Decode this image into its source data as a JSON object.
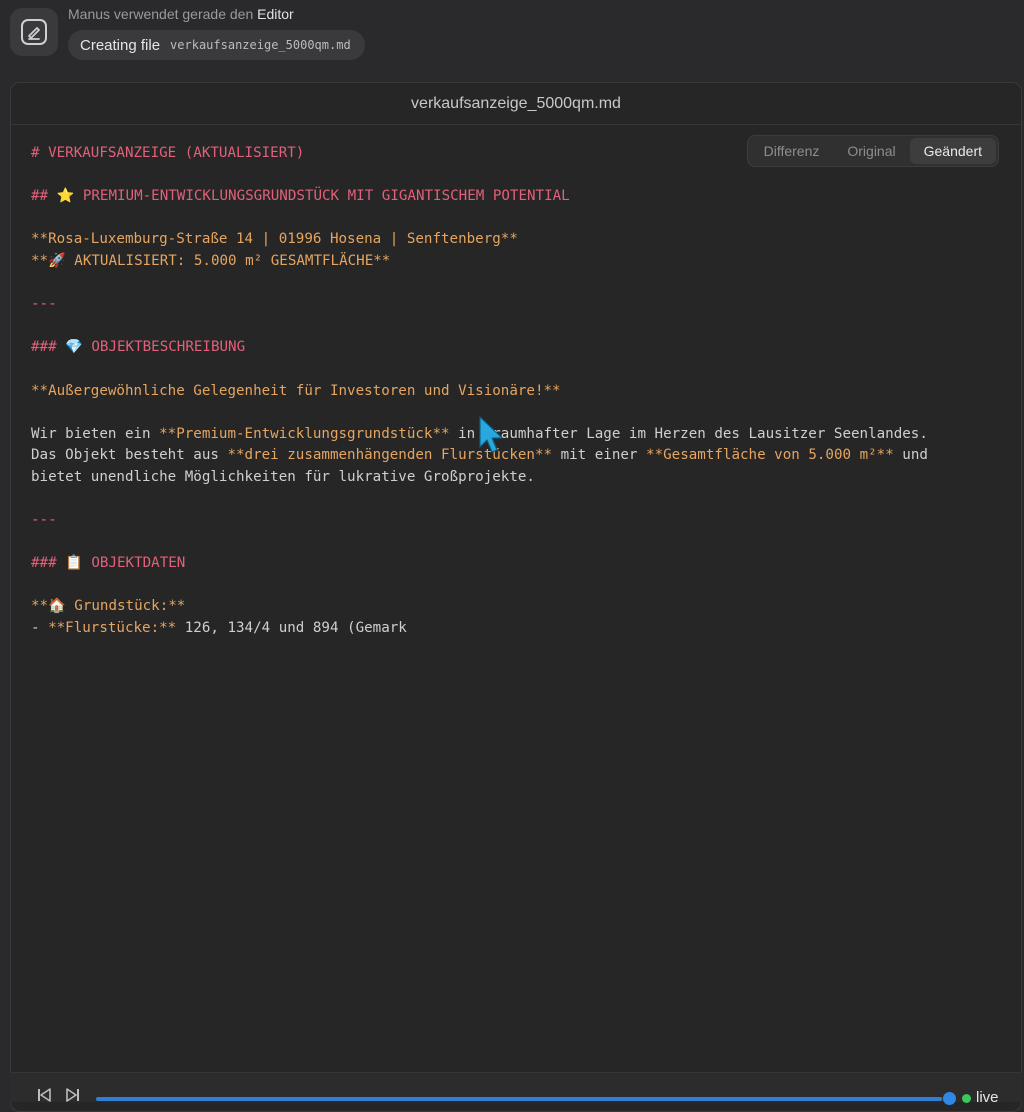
{
  "header": {
    "status_prefix": "Manus verwendet gerade den",
    "status_tool": "Editor",
    "action": "Creating file",
    "file_path": "verkaufsanzeige_5000qm.md",
    "app_icon": "pen-edit-icon"
  },
  "editor": {
    "title": "verkaufsanzeige_5000qm.md",
    "view_tabs": [
      {
        "label": "Differenz",
        "active": false
      },
      {
        "label": "Original",
        "active": false
      },
      {
        "label": "Geändert",
        "active": true
      }
    ],
    "lines": [
      [
        {
          "c": "h",
          "t": "# VERKAUFSANZEIGE (AKTUALISIERT)"
        }
      ],
      [],
      [
        {
          "c": "h",
          "t": "## ⭐ PREMIUM-ENTWICKLUNGSGRUNDSTÜCK MIT GIGANTISCHEM POTENTIAL"
        }
      ],
      [],
      [
        {
          "c": "b",
          "t": "**Rosa-Luxemburg-Straße 14 | 01996 Hosena | Senftenberg**"
        }
      ],
      [
        {
          "c": "b",
          "t": "**🚀 AKTUALISIERT: 5.000 m² GESAMTFLÄCHE**"
        }
      ],
      [],
      [
        {
          "c": "h",
          "t": "---"
        }
      ],
      [],
      [
        {
          "c": "h",
          "t": "### 💎 OBJEKTBESCHREIBUNG"
        }
      ],
      [],
      [
        {
          "c": "b",
          "t": "**Außergewöhnliche Gelegenheit für Investoren und Visionäre!**"
        }
      ],
      [],
      [
        {
          "c": "t",
          "t": "Wir bieten ein "
        },
        {
          "c": "b",
          "t": "**Premium-Entwicklungsgrundstück**"
        },
        {
          "c": "t",
          "t": " in traumhafter Lage im Herzen des Lausitzer Seenlandes."
        }
      ],
      [
        {
          "c": "t",
          "t": "Das Objekt besteht aus "
        },
        {
          "c": "b",
          "t": "**drei zusammenhängenden Flurstücken**"
        },
        {
          "c": "t",
          "t": " mit einer "
        },
        {
          "c": "b",
          "t": "**Gesamtfläche von 5.000 m²**"
        },
        {
          "c": "t",
          "t": " und"
        }
      ],
      [
        {
          "c": "t",
          "t": "bietet unendliche Möglichkeiten für lukrative Großprojekte."
        }
      ],
      [],
      [
        {
          "c": "h",
          "t": "---"
        }
      ],
      [],
      [
        {
          "c": "h",
          "t": "### 📋 OBJEKTDATEN"
        }
      ],
      [],
      [
        {
          "c": "b",
          "t": "**🏠 Grundstück:**"
        }
      ],
      [
        {
          "c": "t",
          "t": "- "
        },
        {
          "c": "b",
          "t": "**Flurstücke:**"
        },
        {
          "c": "t",
          "t": " 126, 134/4 und 894 (Gemark"
        }
      ]
    ]
  },
  "playback": {
    "progress_percent": 99,
    "live_label": "live"
  }
}
